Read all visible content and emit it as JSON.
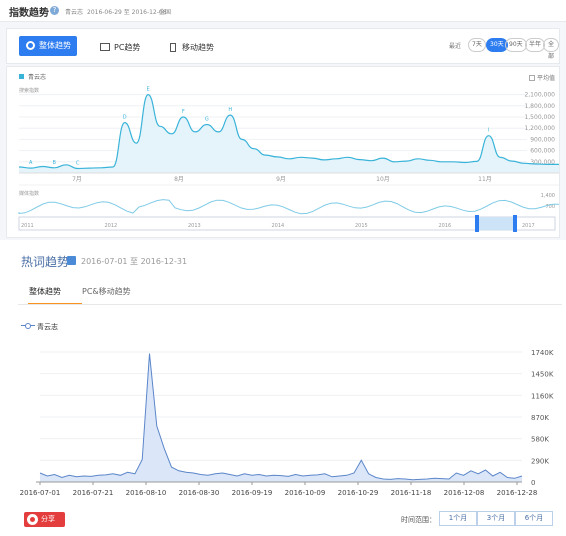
{
  "top_panel": {
    "title": "指数趋势",
    "keyword": "青云志",
    "date_range": "2016-06-29 至 2016-12-08",
    "region": "全国",
    "tabs": [
      "整体趋势",
      "PC趋势",
      "移动趋势"
    ],
    "range_label": "最近",
    "range_options": [
      "7天",
      "30天",
      "90天",
      "半年",
      "全部"
    ],
    "active_range": "30天",
    "legend": "青云志",
    "avg_label": "平均值",
    "search_index_label": "搜索指数",
    "media_index_label": "媒体指数",
    "y_ticks": [
      "2,100,000",
      "1,800,000",
      "1,500,000",
      "1,200,000",
      "900,000",
      "600,000",
      "300,000"
    ],
    "x_ticks": [
      "7月",
      "8月",
      "9月",
      "10月",
      "11月",
      "12月"
    ],
    "event_markers": [
      "A",
      "B",
      "C",
      "D",
      "E",
      "F",
      "G",
      "H",
      "I"
    ],
    "media_ticks": [
      "1,400",
      "700"
    ],
    "years": [
      "2011",
      "2012",
      "2013",
      "2014",
      "2015",
      "2016",
      "2017"
    ]
  },
  "hot_trend": {
    "title": "热词趋势",
    "date_start": "2016-07-01",
    "date_sep": "至",
    "date_end": "2016-12-31",
    "tabs": [
      "整体趋势",
      "PC&移动趋势"
    ],
    "legend": "青云志",
    "share_label": "分享",
    "range_label": "时间范围：",
    "range_buttons": [
      "1个月",
      "3个月",
      "6个月"
    ]
  },
  "chart_data": [
    {
      "type": "area",
      "title": "",
      "series": [
        {
          "name": "青云志",
          "values": [
            160000,
            130000,
            175000,
            140000,
            220000,
            120000,
            130000,
            140000,
            160000,
            1350000,
            800000,
            2100000,
            1250000,
            1050000,
            1500000,
            1100000,
            1300000,
            1100000,
            1550000,
            900000,
            650000,
            480000,
            430000,
            380000,
            420000,
            400000,
            350000,
            380000,
            420000,
            360000,
            330000,
            400000,
            300000,
            320000,
            380000,
            340000,
            300000,
            300000,
            280000,
            310000,
            1000000,
            420000,
            320000,
            260000,
            240000,
            230000,
            230000
          ]
        }
      ],
      "x_ticks": [
        "7月",
        "8月",
        "9月",
        "10月",
        "11月",
        "12月"
      ],
      "y_ticks": [
        "2,100,000",
        "1,800,000",
        "1,500,000",
        "1,200,000",
        "900,000",
        "600,000",
        "300,000"
      ],
      "ylim": [
        0,
        2250000
      ]
    },
    {
      "type": "area",
      "title": "",
      "series": [
        {
          "name": "青云志",
          "values": [
            120000,
            80000,
            100000,
            60000,
            90000,
            70000,
            80000,
            75000,
            90000,
            95000,
            110000,
            90000,
            130000,
            110000,
            300000,
            1720000,
            750000,
            450000,
            200000,
            150000,
            130000,
            120000,
            100000,
            90000,
            110000,
            120000,
            100000,
            80000,
            110000,
            90000,
            100000,
            80000,
            90000,
            85000,
            75000,
            100000,
            80000,
            90000,
            95000,
            110000,
            70000,
            80000,
            90000,
            120000,
            290000,
            110000,
            60000,
            40000,
            35000,
            45000,
            40000,
            30000,
            35000,
            40000,
            50000,
            45000,
            40000,
            120000,
            90000,
            150000,
            110000,
            160000,
            80000,
            130000,
            60000,
            50000,
            80000
          ]
        }
      ],
      "x_ticks": [
        "2016-07-01",
        "2016-07-21",
        "2016-08-10",
        "2016-08-30",
        "2016-09-19",
        "2016-10-09",
        "2016-10-29",
        "2016-11-18",
        "2016-12-08",
        "2016-12-28"
      ],
      "y_ticks": [
        "1740K",
        "1450K",
        "1160K",
        "870K",
        "580K",
        "290K",
        "0"
      ],
      "ylim": [
        0,
        1740000
      ]
    }
  ]
}
